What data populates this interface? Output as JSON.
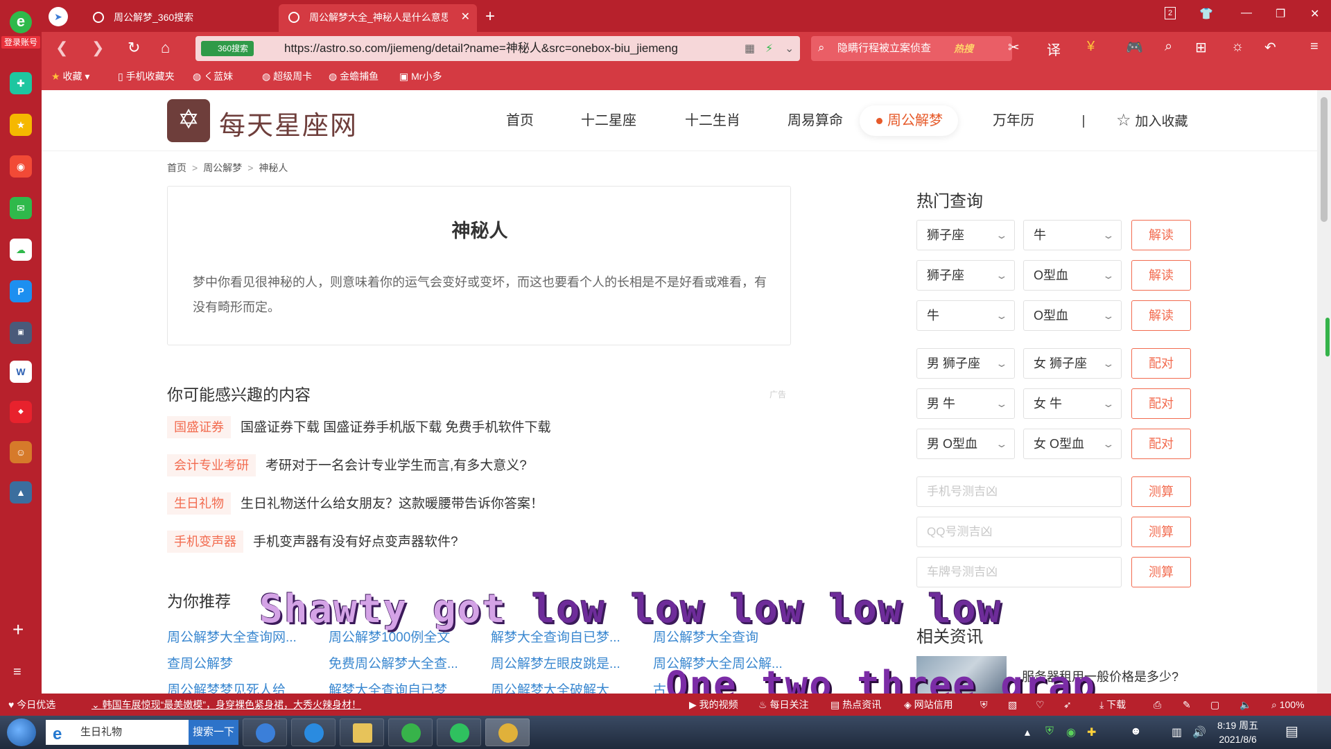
{
  "browser": {
    "tabs": [
      {
        "title": "周公解梦_360搜索"
      },
      {
        "title": "周公解梦大全_神秘人是什么意思"
      }
    ],
    "side_login": "登录账号",
    "url_badge": "360搜索",
    "url": "https://astro.so.com/jiemeng/detail?name=神秘人&src=onebox-biu_jiemeng",
    "search_query": "隐瞒行程被立案侦查",
    "search_hot": "热搜",
    "tab_count": "2",
    "bookmarks": [
      "收藏",
      "手机收藏夹",
      "く蓝妹",
      "超级周卡",
      "金蟾捕鱼",
      "Mr小多"
    ]
  },
  "site": {
    "name": "每天星座网",
    "nav": [
      "首页",
      "十二星座",
      "十二生肖",
      "周易算命",
      "周公解梦",
      "万年历"
    ],
    "nav_sep": "|",
    "fav_label": "加入收藏",
    "breadcrumb": [
      "首页",
      "周公解梦",
      "神秘人"
    ],
    "breadcrumb_sep": ">"
  },
  "dream": {
    "title": "神秘人",
    "text": "梦中你看见很神秘的人，则意味着你的运气会变好或变坏，而这也要看个人的长相是不是好看或难看，有没有畸形而定。"
  },
  "interest": {
    "title": "你可能感兴趣的内容",
    "ad_label": "广告",
    "items": [
      {
        "tag": "国盛证券",
        "text": "国盛证券下载 国盛证券手机版下载 免费手机软件下载"
      },
      {
        "tag": "会计专业考研",
        "text": "考研对于一名会计专业学生而言,有多大意义?"
      },
      {
        "tag": "生日礼物",
        "text": "生日礼物送什么给女朋友？这款暖腰带告诉你答案！"
      },
      {
        "tag": "手机变声器",
        "text": "手机变声器有没有好点变声器软件?"
      }
    ]
  },
  "recommend": {
    "title": "为你推荐",
    "row1": [
      "周公解梦大全查询网...",
      "周公解梦1000例全文",
      "解梦大全查询自已梦...",
      "周公解梦大全查询"
    ],
    "row2": [
      "查周公解梦",
      "免费周公解梦大全查...",
      "周公解梦左眼皮跳是...",
      "周公解梦大全周公解..."
    ],
    "row3": [
      "周公解梦梦见死人给",
      "解梦大全查询自已梦",
      "周公解梦大全破解大",
      "古"
    ]
  },
  "hot_query": {
    "title": "热门查询",
    "rows": [
      {
        "a": "狮子座",
        "b": "牛",
        "btn": "解读"
      },
      {
        "a": "狮子座",
        "b": "O型血",
        "btn": "解读"
      },
      {
        "a": "牛",
        "b": "O型血",
        "btn": "解读"
      },
      {
        "a": "男 狮子座",
        "b": "女 狮子座",
        "btn": "配对"
      },
      {
        "a": "男 牛",
        "b": "女 牛",
        "btn": "配对"
      },
      {
        "a": "男 O型血",
        "b": "女 O型血",
        "btn": "配对"
      }
    ],
    "inputs": [
      {
        "placeholder": "手机号测吉凶",
        "btn": "测算"
      },
      {
        "placeholder": "QQ号测吉凶",
        "btn": "测算"
      },
      {
        "placeholder": "车牌号测吉凶",
        "btn": "测算"
      }
    ]
  },
  "news": {
    "title": "相关资讯",
    "item": "服务器租用一般价格是多少?"
  },
  "overlay": {
    "line1_a": "Shawty got ",
    "line1_b": "low low low low low",
    "line2": "One two three grap"
  },
  "statusbar": {
    "today": "今日优选",
    "headline": "韩国车展惊现“最美嫩模”，身穿裸色紧身裙，大秀火辣身材！",
    "items": [
      "我的视频",
      "每日关注",
      "热点资讯",
      "网站信用"
    ],
    "download": "下载",
    "zoom": "100%"
  },
  "taskbar": {
    "search_text": "生日礼物",
    "search_btn": "搜索一下",
    "time": "8:19 周五",
    "date": "2021/8/6"
  }
}
